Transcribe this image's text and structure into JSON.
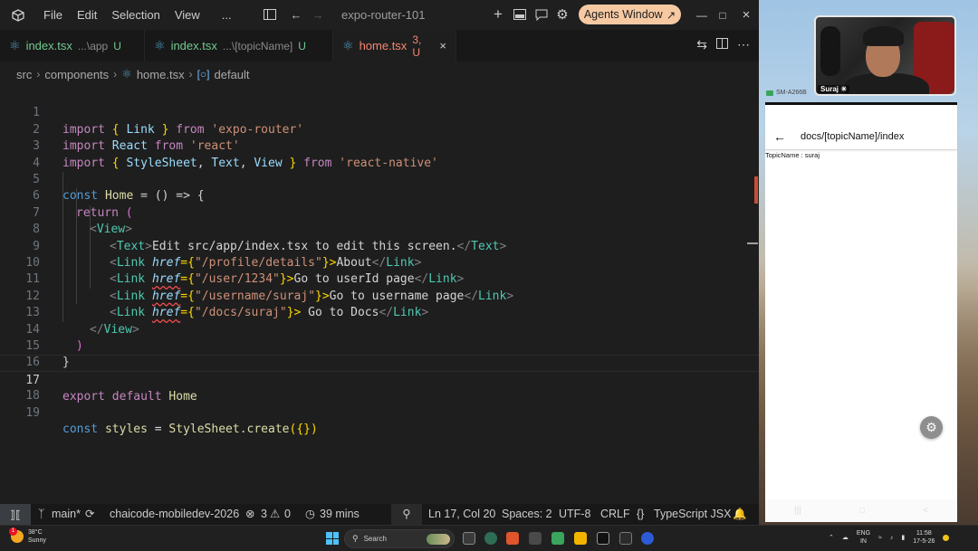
{
  "titlebar": {
    "menu": [
      "File",
      "Edit",
      "Selection",
      "View",
      "..."
    ],
    "title": "expo-router-101",
    "agents_button": "Agents Window",
    "agents_arrow": "↗"
  },
  "tabs": [
    {
      "name": "index.tsx",
      "dir": "...\\app",
      "status": "U",
      "active": false,
      "kind": "untracked"
    },
    {
      "name": "index.tsx",
      "dir": "...\\[topicName]",
      "status": "U",
      "active": false,
      "kind": "untracked"
    },
    {
      "name": "home.tsx",
      "dir": "",
      "status": "3, U",
      "active": true,
      "kind": "error"
    }
  ],
  "breadcrumb": {
    "items": [
      "src",
      "components",
      "home.tsx",
      "default"
    ]
  },
  "editor": {
    "current_line": 17,
    "lines": [
      {
        "n": "1"
      },
      {
        "n": "2"
      },
      {
        "n": "3"
      },
      {
        "n": "4"
      },
      {
        "n": "5"
      },
      {
        "n": "6"
      },
      {
        "n": "7"
      },
      {
        "n": "8"
      },
      {
        "n": "9"
      },
      {
        "n": "10"
      },
      {
        "n": "11"
      },
      {
        "n": "12"
      },
      {
        "n": "13"
      },
      {
        "n": "14"
      },
      {
        "n": "15"
      },
      {
        "n": "16"
      },
      {
        "n": "17"
      },
      {
        "n": "18"
      },
      {
        "n": "19"
      }
    ],
    "code": {
      "l1": {
        "a": "import",
        "b": "{ ",
        "c": "Link",
        "d": " } ",
        "e": "from",
        "f": "'expo-router'"
      },
      "l2": {
        "a": "import",
        "b": "React",
        "c": "from",
        "d": "'react'"
      },
      "l3": {
        "a": "import",
        "b": "{ ",
        "c": "StyleSheet",
        "d": ", ",
        "e": "Text",
        "f": ", ",
        "g": "View",
        "h": " } ",
        "i": "from",
        "j": "'react-native'"
      },
      "l5": {
        "a": "const",
        "b": "Home",
        "c": " = () => {"
      },
      "l6": {
        "a": "return",
        "b": " ("
      },
      "l7": {
        "a": "<",
        "b": "View",
        "c": ">"
      },
      "l8": {
        "a": "<",
        "b": "Text",
        "c": ">",
        "d": "Edit src/app/index.tsx to edit this screen.",
        "e": "</",
        "f": "Text",
        "g": ">"
      },
      "l9": {
        "a": "<",
        "b": "Link",
        "c": "href",
        "d": "={",
        "e": "\"/profile/details\"",
        "f": "}>",
        "g": "About",
        "h": "</",
        "i": "Link",
        "j": ">"
      },
      "l10": {
        "a": "<",
        "b": "Link",
        "c": "href",
        "d": "={",
        "e": "\"/user/1234\"",
        "f": "}>",
        "g": "Go to userId page",
        "h": "</",
        "i": "Link",
        "j": ">"
      },
      "l11": {
        "a": "<",
        "b": "Link",
        "c": "href",
        "d": "={",
        "e": "\"/username/suraj\"",
        "f": "}>",
        "g": "Go to username page",
        "h": "</",
        "i": "Link",
        "j": ">"
      },
      "l12": {
        "a": "<",
        "b": "Link",
        "c": "href",
        "d": "={",
        "e": "\"/docs/suraj\"",
        "f": "}>",
        "g": " Go to Docs",
        "h": "</",
        "i": "Link",
        "j": ">"
      },
      "l13": {
        "a": "</",
        "b": "View",
        "c": ">"
      },
      "l14": {
        "a": ")"
      },
      "l15": {
        "a": "}"
      },
      "l17": {
        "a": "export",
        "b": "default",
        "c": "Home"
      },
      "l19": {
        "a": "const",
        "b": "styles",
        "c": " = ",
        "d": "StyleSheet",
        "e": ".",
        "f": "create",
        "g": "({})"
      }
    }
  },
  "statusbar": {
    "branch": "main*",
    "repo": "chaicode-mobiledev-2026",
    "errors": "3",
    "warnings": "0",
    "time": "39 mins",
    "position": "Ln 17, Col 20",
    "spaces": "Spaces: 2",
    "encoding": "UTF-8",
    "eol": "CRLF",
    "language": "TypeScript JSX"
  },
  "webcam": {
    "label": "Suraj ☀"
  },
  "phone": {
    "device_label": "SM-A266B",
    "header_title": "docs/[topicName]/index",
    "content_text": "TopicName : suraj"
  },
  "taskbar": {
    "temp": "38°C",
    "weather": "Sunny",
    "weather_badge": "1",
    "search": "Search",
    "lang1": "ENG",
    "lang2": "IN",
    "clock_time": "11:58",
    "clock_date": "17-5-26"
  }
}
